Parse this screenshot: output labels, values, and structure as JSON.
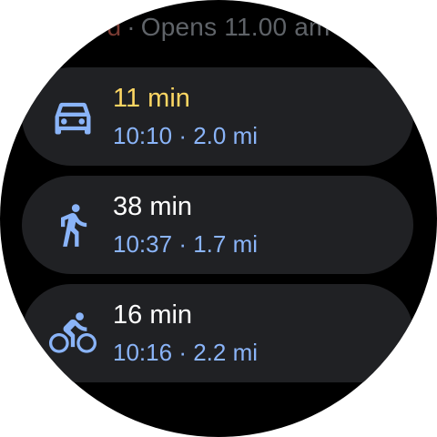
{
  "header": {
    "closed_fragment": "d",
    "separator": "·",
    "opens_text": "Opens 11.00 am"
  },
  "routes": [
    {
      "mode": "driving",
      "icon": "car-icon",
      "duration": "11 min",
      "arrival": "10:10",
      "separator": "·",
      "distance": "2.0 mi",
      "duration_color": "#fdd663"
    },
    {
      "mode": "walking",
      "icon": "walk-icon",
      "duration": "38 min",
      "arrival": "10:37",
      "separator": "·",
      "distance": "1.7 mi",
      "duration_color": "#ffffff"
    },
    {
      "mode": "cycling",
      "icon": "bike-icon",
      "duration": "16 min",
      "arrival": "10:16",
      "separator": "·",
      "distance": "2.2 mi",
      "duration_color": "#ffffff"
    }
  ],
  "colors": {
    "background": "#000000",
    "card": "#202124",
    "accent_blue": "#8ab4f8",
    "fastest_yellow": "#fdd663",
    "muted_text": "#5f6368"
  }
}
